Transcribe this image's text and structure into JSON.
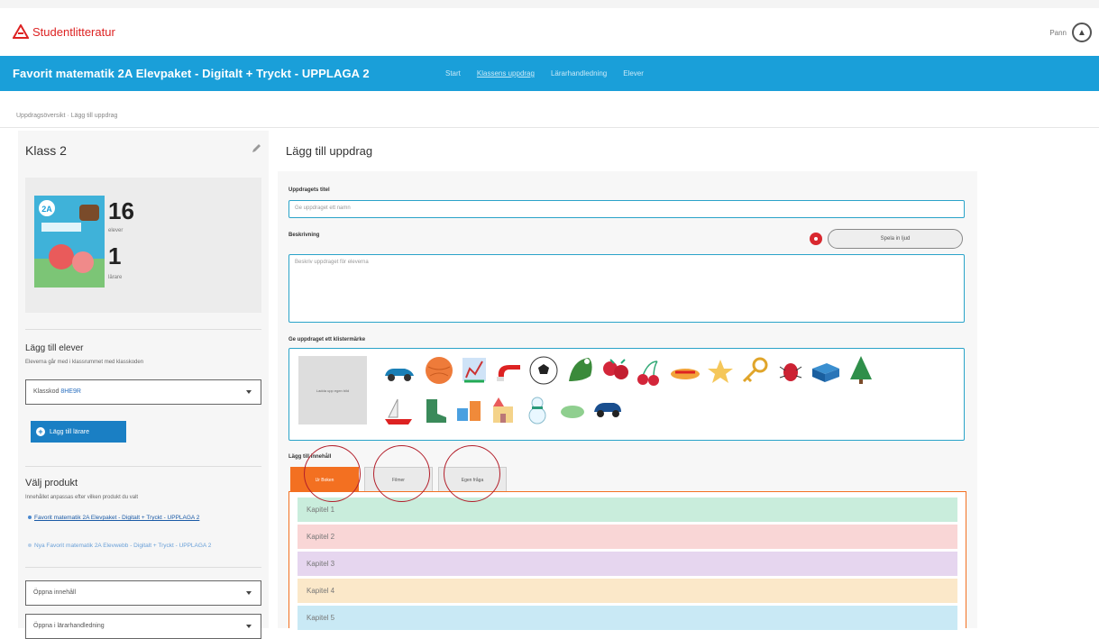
{
  "brand": {
    "name": "Studentlitteratur",
    "color": "#d22222"
  },
  "user": {
    "name": "Pann"
  },
  "nav": {
    "title": "Favorit matematik 2A Elevpaket - Digitalt + Tryckt - UPPLAGA 2",
    "links": [
      "Start",
      "Klassens uppdrag",
      "Lärarhandledning",
      "Elever"
    ],
    "active_index": 1,
    "bg": "#1a9fd9"
  },
  "breadcrumb": {
    "text": "Uppdragsöversikt · Lägg till uppdrag"
  },
  "sidebar": {
    "class_name": "Klass 2",
    "students_count": "16",
    "students_label": "elever",
    "teachers_count": "1",
    "teachers_label": "lärare",
    "add_title": "Lägg till elever",
    "add_sub": "Eleverna går med i klassrummet med klasskoden",
    "class_code_label": "Klasskod",
    "class_code_value": "8HE9R",
    "add_teacher_label": "Lägg till lärare",
    "product_title": "Välj produkt",
    "product_sub": "Innehållet anpassas efter vilken produkt du valt",
    "products": [
      "Favorit matematik 2A Elevpaket - Digitalt + Tryckt - UPPLAGA 2",
      "Nya Favorit matematik 2A Elevwebb - Digitalt + Tryckt - UPPLAGA 2"
    ],
    "select_topic": "Öppna innehåll",
    "select_teacher": "Öppna i lärarhandledning"
  },
  "main": {
    "title": "Lägg till uppdrag",
    "name_label": "Uppdragets titel",
    "name_placeholder": "Ge uppdraget ett namn",
    "desc_label": "Beskrivning",
    "desc_placeholder": "Beskriv uppdraget för eleverna",
    "record_label": "Spela in ljud",
    "sticker_label": "Ge uppdraget ett klistermärke",
    "upload_label": "Ladda upp egen bild",
    "content_label": "Lägg till innehåll",
    "tabs": [
      "Ur Boken",
      "Filmer",
      "Egen fråga"
    ],
    "active_tab": 0,
    "accent": "#f37021",
    "chapters": [
      "Kapitel 1",
      "Kapitel 2",
      "Kapitel 3",
      "Kapitel 4",
      "Kapitel 5"
    ],
    "chapter_colors": [
      "#c9eddc",
      "#f9d6d6",
      "#e6d6ef",
      "#fbe8c9",
      "#c9e9f5"
    ]
  }
}
